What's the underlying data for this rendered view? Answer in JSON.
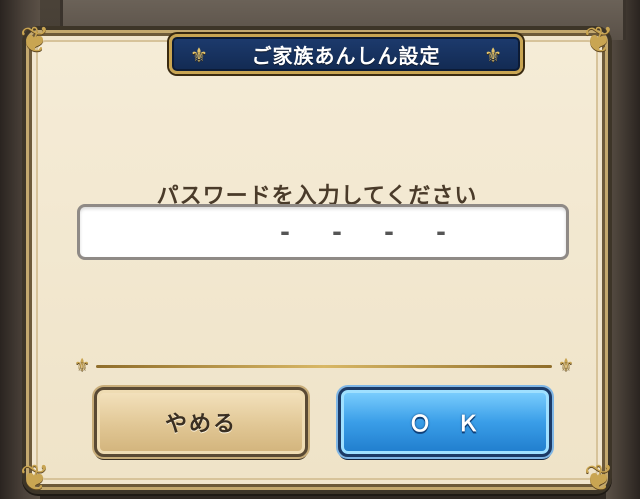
{
  "dialog": {
    "title": "ご家族あんしん設定",
    "prompt": "パスワードを入力してください",
    "password_slots": [
      "-",
      "-",
      "-",
      "-"
    ]
  },
  "buttons": {
    "cancel_label": "やめる",
    "ok_label": "Ｏ　Ｋ"
  },
  "icons": {
    "ornament": "fleur-de-lis-icon",
    "corner": "ornate-corner-icon"
  },
  "colors": {
    "banner": "#1d3b6e",
    "panel": "#f1e6cf",
    "ok_button": "#3a9ee8",
    "cancel_button": "#e1c795",
    "gold_trim": "#c9a552"
  }
}
